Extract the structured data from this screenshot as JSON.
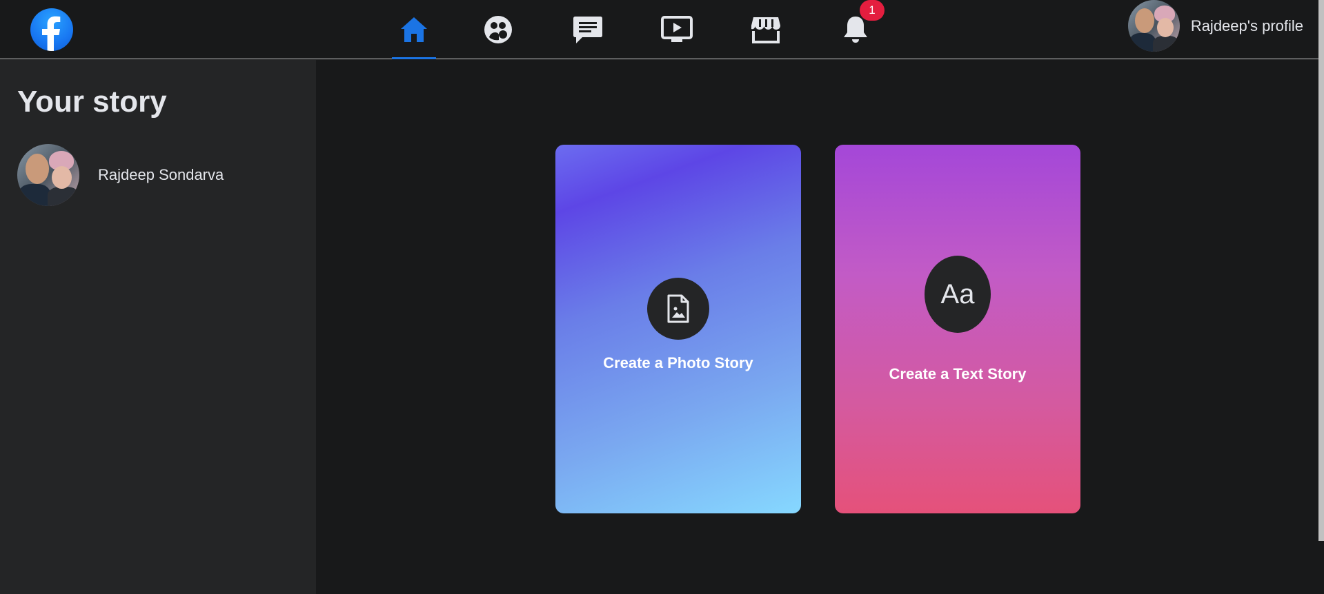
{
  "header": {
    "notification_count": "1",
    "profile_label": "Rajdeep's profile"
  },
  "nav": {
    "items": [
      {
        "name": "home",
        "icon": "home-icon",
        "active": true
      },
      {
        "name": "groups",
        "icon": "groups-icon",
        "active": false
      },
      {
        "name": "messages",
        "icon": "messenger-icon",
        "active": false
      },
      {
        "name": "watch",
        "icon": "watch-icon",
        "active": false
      },
      {
        "name": "marketplace",
        "icon": "marketplace-icon",
        "active": false
      },
      {
        "name": "notifications",
        "icon": "bell-icon",
        "active": false
      }
    ]
  },
  "sidebar": {
    "title": "Your story",
    "user_name": "Rajdeep Sondarva"
  },
  "cards": {
    "photo": {
      "label": "Create a Photo Story",
      "icon": "photo-file-icon"
    },
    "text": {
      "label": "Create a Text Story",
      "glyph": "Aa"
    }
  },
  "colors": {
    "brand": "#1877f2",
    "active_tab": "#1b74e4",
    "badge": "#e41e3f",
    "background": "#18191a",
    "sidebar": "#242526"
  }
}
